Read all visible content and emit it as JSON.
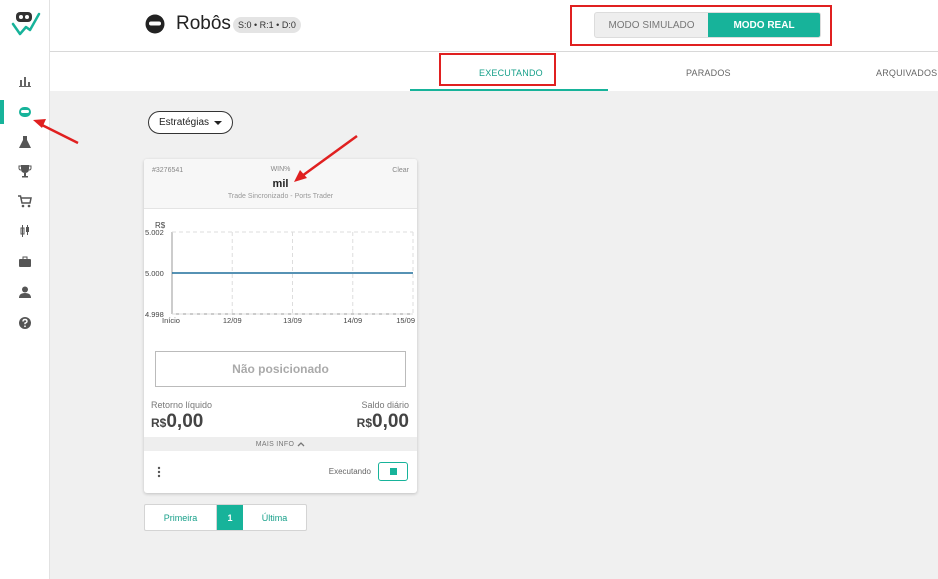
{
  "header": {
    "title": "Robôs",
    "counts": "S:0 • R:1 • D:0",
    "mode_simulated": "MODO SIMULADO",
    "mode_real": "MODO REAL"
  },
  "tabs": [
    {
      "label": "EXECUTANDO",
      "active": true
    },
    {
      "label": "PARADOS",
      "active": false
    },
    {
      "label": "ARQUIVADOS",
      "active": false
    }
  ],
  "sidebar": {
    "items": [
      {
        "icon": "bar-chart-icon"
      },
      {
        "icon": "robot-icon",
        "active": true
      },
      {
        "icon": "flask-icon"
      },
      {
        "icon": "trophy-icon"
      },
      {
        "icon": "cart-icon"
      },
      {
        "icon": "candlestick-icon"
      },
      {
        "icon": "briefcase-icon"
      },
      {
        "icon": "user-icon"
      },
      {
        "icon": "help-icon"
      }
    ]
  },
  "filters": {
    "strategies_label": "Estratégias"
  },
  "card": {
    "id": "#3276541",
    "symbol": "WIN%",
    "clear_label": "Clear",
    "name": "mil",
    "subtitle": "Trade Sincronizado - Ports Trader",
    "position_status": "Não posicionado",
    "net_return_label": "Retorno líquido",
    "net_return_currency": "R$",
    "net_return_value": "0,00",
    "daily_balance_label": "Saldo diário",
    "daily_balance_currency": "R$",
    "daily_balance_value": "0,00",
    "more_info_label": "MAIS INFO",
    "status_label": "Executando"
  },
  "chart_data": {
    "type": "line",
    "ylabel": "R$",
    "x": [
      "Início",
      "12/09",
      "13/09",
      "14/09",
      "15/09"
    ],
    "yticks": [
      "5.002",
      "5.000",
      "4.998"
    ],
    "ylim": [
      4.998,
      5.002
    ],
    "series": [
      {
        "values": [
          5.0,
          5.0,
          5.0,
          5.0,
          5.0
        ]
      }
    ],
    "grid": true,
    "color": "#1f6f9c"
  },
  "pagination": {
    "first": "Primeira",
    "current": "1",
    "last": "Última"
  },
  "colors": {
    "accent": "#17b39a",
    "annotation": "#e02020"
  }
}
